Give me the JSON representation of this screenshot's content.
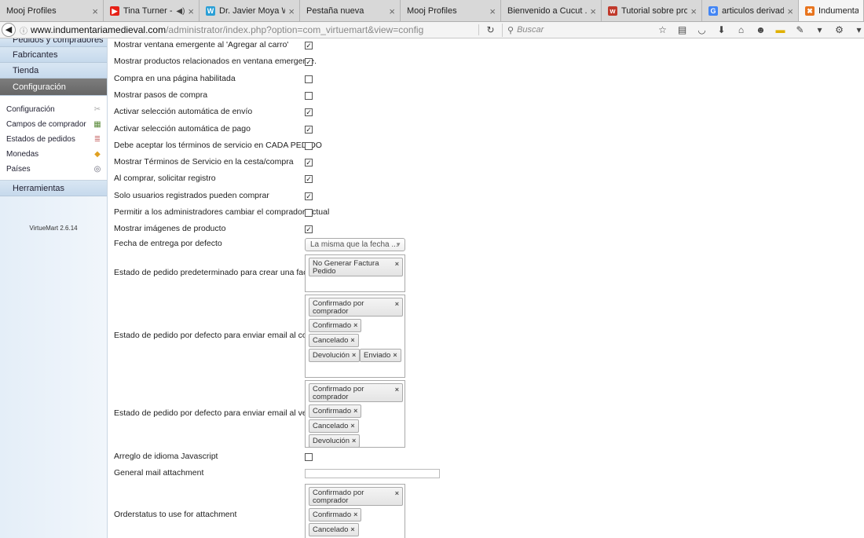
{
  "tabs": [
    {
      "title": "Mooj Profiles",
      "favicon": "",
      "color": "#d8d8d8",
      "audio": false
    },
    {
      "title": "Tina Turner - On...",
      "favicon": "▶",
      "color": "#e62117",
      "audio": true
    },
    {
      "title": "Dr. Javier Moya Web...",
      "favicon": "W",
      "color": "#2a9fd6",
      "audio": false
    },
    {
      "title": "Pestaña nueva",
      "favicon": "",
      "color": "#d8d8d8",
      "audio": false
    },
    {
      "title": "Mooj Profiles",
      "favicon": "",
      "color": "#d8d8d8",
      "audio": false
    },
    {
      "title": "Bienvenido a Cucut ...",
      "favicon": "",
      "color": "#bbbbbb",
      "audio": false
    },
    {
      "title": "Tutorial sobre produ...",
      "favicon": "w",
      "color": "#c0392b",
      "audio": false
    },
    {
      "title": "articulos derivados j...",
      "favicon": "G",
      "color": "#4285f4",
      "audio": false
    },
    {
      "title": "Indumentaria Me",
      "favicon": "✖",
      "color": "#e8741e",
      "audio": false
    }
  ],
  "nav": {
    "url_domain": "www.indumentariamedieval.com",
    "url_path": "/administrator/index.php?option=com_virtuemart&view=config",
    "search_placeholder": "Buscar"
  },
  "sidebar": {
    "partial_top": "Pedidos y compradores",
    "heads": [
      "Fabricantes",
      "Tienda",
      "Configuración"
    ],
    "sub_items": [
      {
        "label": "Configuración",
        "icon": "✂",
        "icon_color": "#aaa"
      },
      {
        "label": "Campos de comprador",
        "icon": "▦",
        "icon_color": "#5a8a3a"
      },
      {
        "label": "Estados de pedidos",
        "icon": "≣",
        "icon_color": "#c77"
      },
      {
        "label": "Monedas",
        "icon": "◆",
        "icon_color": "#e0a020"
      },
      {
        "label": "Países",
        "icon": "◎",
        "icon_color": "#667"
      }
    ],
    "tools_head": "Herramientas",
    "version": "VirtueMart 2.6.14"
  },
  "settings": [
    {
      "label": "Mostrar ventana emergente al 'Agregar al carro'",
      "checked": true
    },
    {
      "label": "Mostrar productos relacionados en ventana emergente.",
      "checked": true
    },
    {
      "label": "Compra en una página habilitada",
      "checked": false
    },
    {
      "label": "Mostrar pasos de compra",
      "checked": false
    },
    {
      "label": "Activar selección automática de envío",
      "checked": true
    },
    {
      "label": "Activar selección automática de pago",
      "checked": true
    },
    {
      "label": "Debe aceptar los términos de servicio en CADA PEDIDO",
      "checked": false
    },
    {
      "label": "Mostrar Términos de Servicio en la cesta/compra",
      "checked": true
    },
    {
      "label": "Al comprar, solicitar registro",
      "checked": true
    },
    {
      "label": "Solo usuarios registrados pueden comprar",
      "checked": true
    },
    {
      "label": "Permitir a los administradores cambiar el comprador actual",
      "checked": false
    },
    {
      "label": "Mostrar imágenes de producto",
      "checked": true
    }
  ],
  "delivery": {
    "label": "Fecha de entrega por defecto",
    "value": "La misma que la fecha ..."
  },
  "invoice": {
    "label": "Estado de pedido predeterminado para crear una factura",
    "chips": [
      "No Generar Factura Pedido"
    ]
  },
  "email_buyer": {
    "label": "Estado de pedido por defecto para enviar email al comprador",
    "chips": [
      "Confirmado por comprador",
      "Confirmado",
      "Cancelado",
      "Devolución",
      "Enviado"
    ]
  },
  "email_vendor": {
    "label": "Estado de pedido por defecto para enviar email al vendedor",
    "chips": [
      "Confirmado por comprador",
      "Confirmado",
      "Cancelado",
      "Devolución"
    ]
  },
  "js_fix": {
    "label": "Arreglo de idioma Javascript",
    "checked": false
  },
  "mail_attach": {
    "label": "General mail attachment",
    "value": ""
  },
  "attach_status": {
    "label": "Orderstatus to use for attachment",
    "chips": [
      "Confirmado por comprador",
      "Confirmado",
      "Cancelado"
    ]
  }
}
